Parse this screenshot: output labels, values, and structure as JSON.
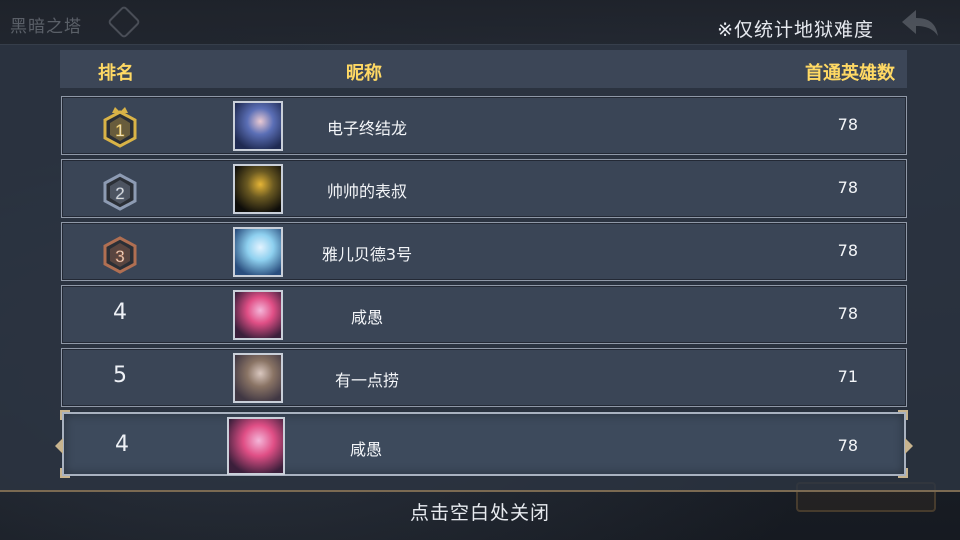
{
  "top": {
    "game_title": "黑暗之塔",
    "note": "※仅统计地狱难度"
  },
  "table": {
    "headers": {
      "rank": "排名",
      "nickname": "昵称",
      "count": "首通英雄数"
    },
    "rows": [
      {
        "rank": "1",
        "nickname": "电子终结龙",
        "count": "78",
        "medal": "gold",
        "avatar_colors": [
          "#1f2a52",
          "#5b6fb6",
          "#e9c9d2"
        ]
      },
      {
        "rank": "2",
        "nickname": "帅帅的表叔",
        "count": "78",
        "medal": "silver",
        "avatar_colors": [
          "#0e0d0a",
          "#6b5a22",
          "#e6b536"
        ]
      },
      {
        "rank": "3",
        "nickname": "雅儿贝德3号",
        "count": "78",
        "medal": "bronze",
        "avatar_colors": [
          "#2a4e7e",
          "#8ed0ef",
          "#e3f3ff"
        ]
      },
      {
        "rank": "4",
        "nickname": "咸愚",
        "count": "78",
        "medal": "none",
        "avatar_colors": [
          "#3b1f3b",
          "#e04f86",
          "#f4b6d9"
        ]
      },
      {
        "rank": "5",
        "nickname": "有一点捞",
        "count": "71",
        "medal": "none",
        "avatar_colors": [
          "#403743",
          "#8a7465",
          "#d9c7bf"
        ]
      }
    ],
    "self": {
      "rank": "4",
      "nickname": "咸愚",
      "count": "78",
      "avatar_colors": [
        "#3b1f3b",
        "#e04f86",
        "#f4b6d9"
      ]
    }
  },
  "footer": {
    "close_hint": "点击空白处关闭"
  },
  "colors": {
    "header_text": "#ffd964",
    "gold": "#d9b347",
    "silver": "#8d9bb3",
    "bronze": "#b06f52"
  }
}
